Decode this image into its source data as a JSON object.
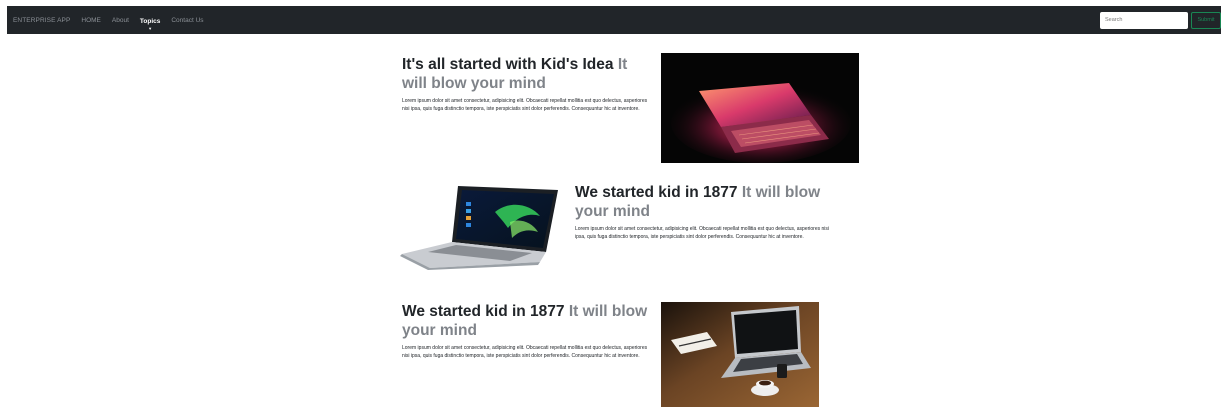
{
  "navbar": {
    "brand": "ENTERPRISE APP",
    "links": [
      "HOME",
      "About",
      "Topics",
      "Contact Us"
    ],
    "active_link": "Topics",
    "search_placeholder": "Search",
    "submit_label": "Submit"
  },
  "features": [
    {
      "heading_main": "It's all started with Kid's Idea",
      "heading_muted": "It will blow your mind",
      "lead": "Lorem ipsum dolor sit amet consectetur, adipisicing elit. Obcaecati repellat mollitia est quo delectus, asperiores nisi ipsa, quis fuga distinctio tempora, iste perspiciatis sint dolor perferendis. Consequuntur hic at inventore."
    },
    {
      "heading_main": "We started kid in 1877",
      "heading_muted": "It will blow your mind",
      "lead": "Lorem ipsum dolor sit amet consectetur, adipisicing elit. Obcaecati repellat mollitia est quo delectus, asperiores nisi ipsa, quis fuga distinctio tempora, iste perspiciatis sint dolor perferendis. Consequuntur hic at inventore."
    },
    {
      "heading_main": "We started kid in 1877",
      "heading_muted": "It will blow your mind",
      "lead": "Lorem ipsum dolor sit amet consectetur, adipisicing elit. Obcaecati repellat mollitia est quo delectus, asperiores nisi ipsa, quis fuga distinctio tempora, iste perspiciatis sint dolor perferendis. Consequuntur hic at inventore."
    }
  ],
  "colors": {
    "navbar_bg": "#212529",
    "nav_text": "#8b9096",
    "heading": "#212529",
    "heading_muted": "#7f8389",
    "submit": "#198754"
  }
}
